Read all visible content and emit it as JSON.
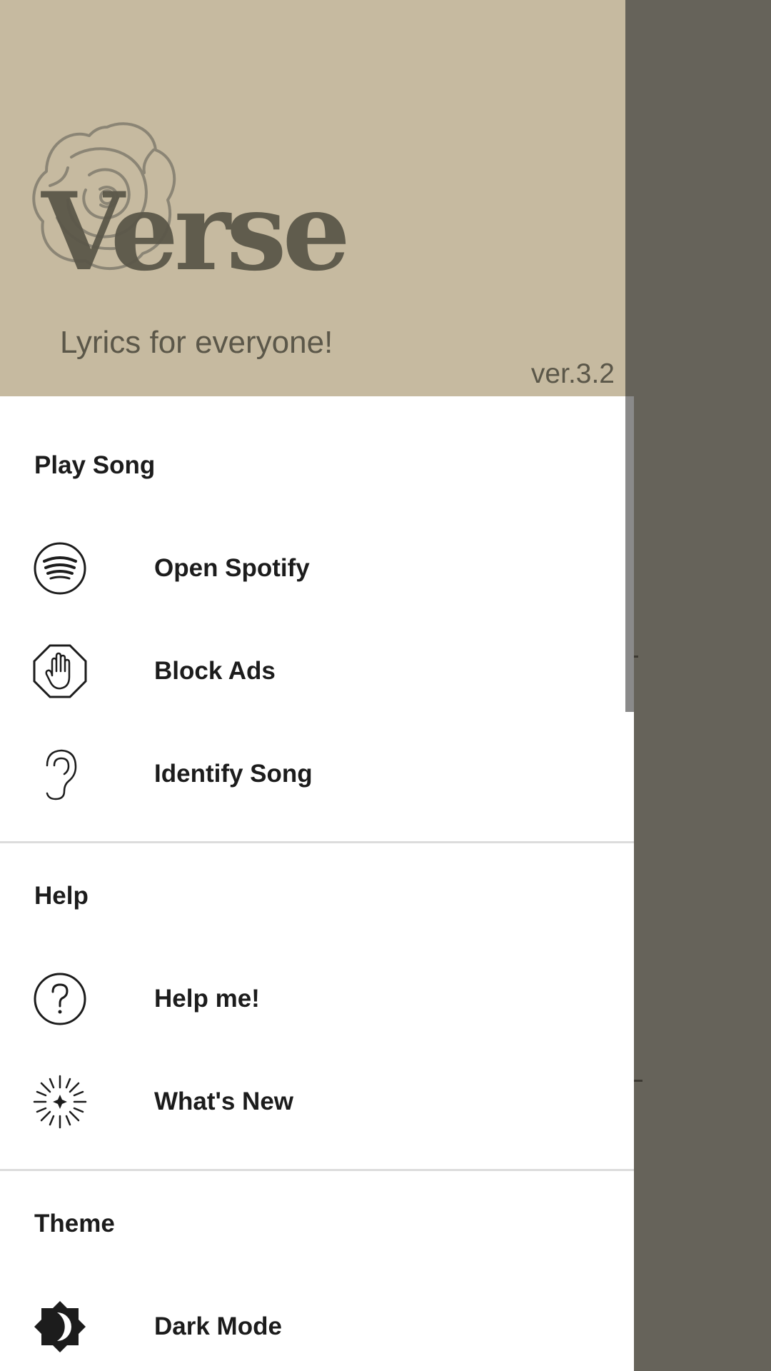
{
  "header": {
    "brand_title": "Verse",
    "tagline": "Lyrics for everyone!",
    "version": "ver.3.2",
    "accent_color": "#c6baa0",
    "text_color": "#5b5749"
  },
  "sections": {
    "play_song": {
      "title": "Play Song",
      "items": [
        {
          "label": "Open Spotify",
          "icon": "spotify-icon"
        },
        {
          "label": "Block Ads",
          "icon": "stop-hand-icon"
        },
        {
          "label": "Identify Song",
          "icon": "ear-icon"
        }
      ]
    },
    "help": {
      "title": "Help",
      "items": [
        {
          "label": "Help me!",
          "icon": "question-circle-icon"
        },
        {
          "label": "What's New",
          "icon": "sparkle-icon"
        }
      ]
    },
    "theme": {
      "title": "Theme",
      "items": [
        {
          "label": "Dark Mode",
          "icon": "dark-mode-icon"
        }
      ]
    }
  },
  "colors": {
    "scrim": "#66635a",
    "drawer_bg": "#ffffff",
    "divider": "#dcdcdc"
  }
}
